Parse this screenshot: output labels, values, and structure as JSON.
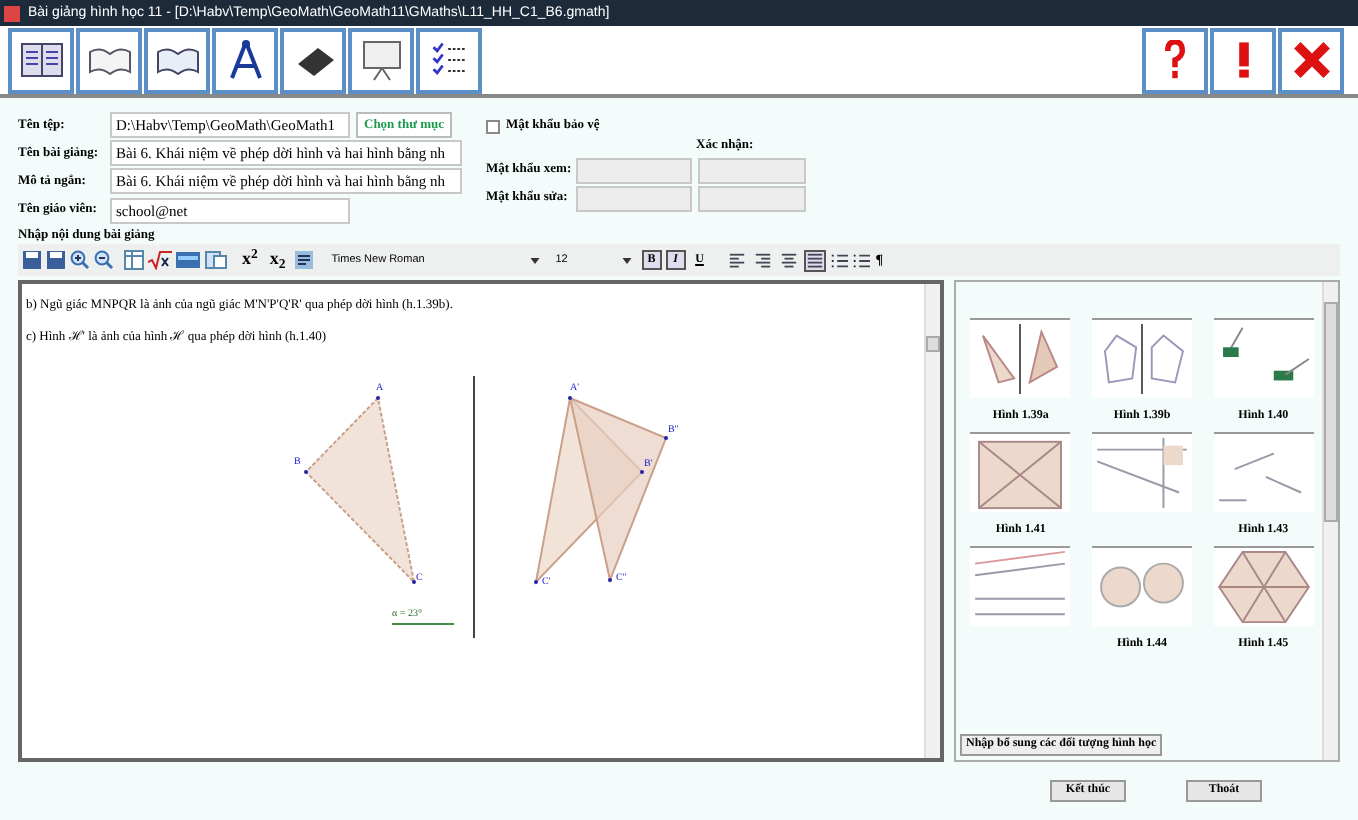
{
  "window": {
    "title": "Bài giảng hình học 11 - [D:\\Habv\\Temp\\GeoMath\\GeoMath11\\GMaths\\L11_HH_C1_B6.gmath]"
  },
  "form": {
    "file_label": "Tên tệp:",
    "file_value": "D:\\Habv\\Temp\\GeoMath\\GeoMath1",
    "choose_folder": "Chọn thư mục",
    "lesson_label": "Tên bài giảng:",
    "lesson_value": "Bài 6. Khái niệm về phép dời hình và hai hình bằng nh",
    "desc_label": "Mô tả ngắn:",
    "desc_value": "Bài 6. Khái niệm về phép dời hình và hai hình bằng nh",
    "teacher_label": "Tên giáo viên:",
    "teacher_value": "school@net",
    "password_protect": {
      "label": "Mật khẩu bảo vệ",
      "checked": false
    },
    "confirm_label": "Xác nhận:",
    "view_password_label": "Mật khẩu xem:",
    "edit_password_label": "Mật khẩu sửa:"
  },
  "content_label": "Nhập nội dung bài giảng",
  "editor_toolbar": {
    "superscript": "x$^{2}$",
    "subscript": "x$_{2}$",
    "font": "Times New Roman",
    "size": "12",
    "formats": [
      {
        "label": "B",
        "selected": true
      },
      {
        "label": "I",
        "selected": true
      },
      {
        "label": "U",
        "selected": false
      }
    ],
    "aligns": [
      {
        "kind": "left",
        "selected": false
      },
      {
        "kind": "right",
        "selected": false
      },
      {
        "kind": "center",
        "selected": false
      },
      {
        "kind": "justify",
        "selected": true
      }
    ],
    "paragraph": "¶"
  },
  "editor": {
    "lines": [
      "b) Ngũ giác MNPQR là ảnh của ngũ giác M'N'P'Q'R' qua phép dời hình (h.1.39b).",
      "c) Hình ℋ' là ảnh của hình ℋ qua phép dời hình (h.1.40)"
    ],
    "figure_labels": [
      "A",
      "B",
      "C",
      "A'",
      "B''",
      "B'",
      "C'",
      "C''",
      "α = 23°"
    ]
  },
  "gallery": {
    "items": [
      {
        "kind": "two-triangles",
        "caption": "Hình 1.39a"
      },
      {
        "kind": "pentagons",
        "caption": "Hình 1.39b"
      },
      {
        "kind": "shapes",
        "caption": "Hình 1.40"
      },
      {
        "kind": "square",
        "caption": "Hình 1.41"
      },
      {
        "kind": "lines"
      },
      {
        "kind": "segments",
        "caption": "Hình 1.43"
      },
      {
        "kind": "parallel"
      },
      {
        "kind": "circles",
        "caption": "Hình 1.44"
      },
      {
        "kind": "hexagon",
        "caption": "Hình 1.45"
      }
    ],
    "add_button": "Nhập bổ sung các đối tượng hình học"
  },
  "buttons": [
    "Kết thúc",
    "Thoát"
  ]
}
